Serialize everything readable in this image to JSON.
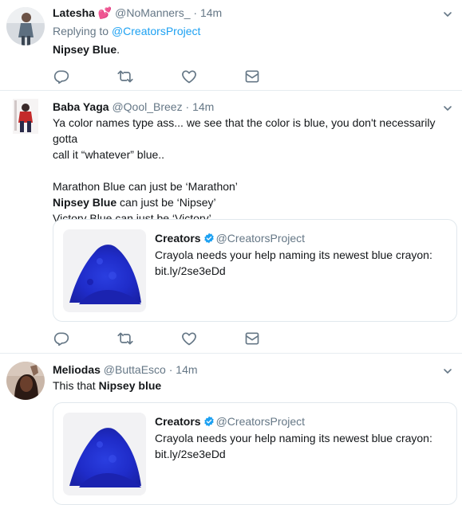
{
  "colors": {
    "accent": "#1da1f2",
    "heart": "#e0245e",
    "secondary": "#657786",
    "primary": "#14171a"
  },
  "tweets": [
    {
      "name": "Latesha",
      "emoji": "💕",
      "handle": "@NoManners_",
      "dot": "·",
      "time": "14m",
      "replying_prefix": "Replying to ",
      "replying_handle": "@CreatorsProject",
      "text_bold": "Nipsey Blue",
      "text_rest": "."
    },
    {
      "name": "Baba Yaga",
      "handle": "@Qool_Breez",
      "dot": "·",
      "time": "14m",
      "line1": "Ya color names type ass... we see that the color is blue, you don't necessarily gotta",
      "line2": "call it “whatever” blue..",
      "line3": "Marathon Blue can just be ‘Marathon’",
      "line4_bold": "Nipsey Blue",
      "line4_rest": " can just be ‘Nipsey’",
      "line5": "Victory Blue can just be ‘Victory’",
      "card": {
        "name": "Creators",
        "handle": "@CreatorsProject",
        "text": "Crayola needs your help naming its newest blue crayon:",
        "link": "bit.ly/2se3eDd"
      }
    },
    {
      "name": "Meliodas",
      "handle": "@ButtaEsco",
      "dot": "·",
      "time": "14m",
      "text_pre": "This that ",
      "text_bold": "Nipsey blue",
      "card": {
        "name": "Creators",
        "handle": "@CreatorsProject",
        "text": "Crayola needs your help naming its newest blue crayon:",
        "link": "bit.ly/2se3eDd"
      }
    }
  ],
  "icons": [
    "reply-icon",
    "retweet-icon",
    "like-icon",
    "message-icon",
    "chevron-down-icon",
    "verified-icon"
  ]
}
